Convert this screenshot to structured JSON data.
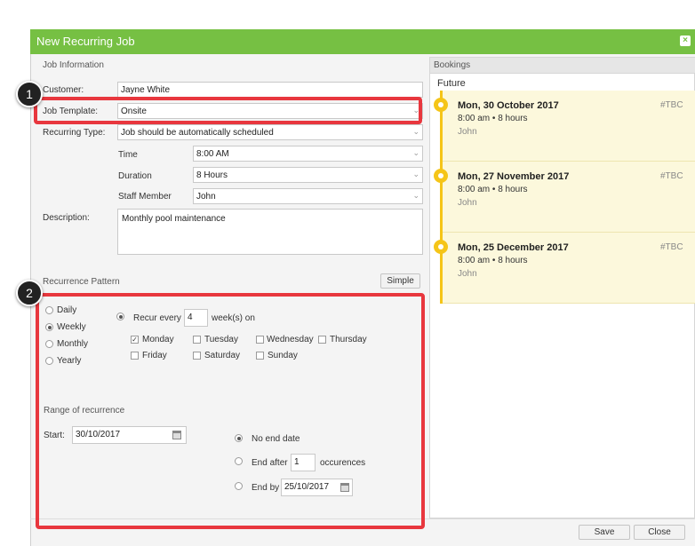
{
  "dialog": {
    "title": "New Recurring Job",
    "close_icon": "×"
  },
  "job_info": {
    "section_title": "Job Information",
    "customer_label": "Customer:",
    "customer_value": "Jayne White",
    "template_label": "Job Template:",
    "template_value": "Onsite",
    "recurring_type_label": "Recurring Type:",
    "recurring_type_value": "Job should be automatically scheduled",
    "time_label": "Time",
    "time_value": "8:00 AM",
    "duration_label": "Duration",
    "duration_value": "8 Hours",
    "staff_label": "Staff Member",
    "staff_value": "John",
    "description_label": "Description:",
    "description_value": "Monthly  pool maintenance"
  },
  "recurrence": {
    "section_title": "Recurrence Pattern",
    "simple_button": "Simple",
    "frequencies": [
      "Daily",
      "Weekly",
      "Monthly",
      "Yearly"
    ],
    "selected_frequency": "Weekly",
    "recur_every_label": "Recur every",
    "recur_every_value": "4",
    "recur_unit_label": "week(s) on",
    "days": [
      {
        "label": "Monday",
        "checked": true
      },
      {
        "label": "Tuesday",
        "checked": false
      },
      {
        "label": "Wednesday",
        "checked": false
      },
      {
        "label": "Thursday",
        "checked": false
      },
      {
        "label": "Friday",
        "checked": false
      },
      {
        "label": "Saturday",
        "checked": false
      },
      {
        "label": "Sunday",
        "checked": false
      }
    ]
  },
  "range": {
    "section_title": "Range of recurrence",
    "start_label": "Start:",
    "start_value": "30/10/2017",
    "no_end_label": "No end date",
    "end_after_label": "End after",
    "end_after_value": "1",
    "occurrences_label": "occurences",
    "end_by_label": "End by",
    "end_by_value": "25/10/2017",
    "selected": "No end date"
  },
  "bookings": {
    "title": "Bookings",
    "group": "Future",
    "items": [
      {
        "date": "Mon, 30 October 2017",
        "time": "8:00 am • 8 hours",
        "staff": "John",
        "tag": "#TBC"
      },
      {
        "date": "Mon, 27 November 2017",
        "time": "8:00 am • 8 hours",
        "staff": "John",
        "tag": "#TBC"
      },
      {
        "date": "Mon, 25 December 2017",
        "time": "8:00 am • 8 hours",
        "staff": "John",
        "tag": "#TBC"
      }
    ]
  },
  "footer": {
    "save_label": "Save",
    "close_label": "Close"
  },
  "annotations": {
    "badge_1": "1",
    "badge_2": "2"
  },
  "colors": {
    "titlebar": "#76c043",
    "callout": "#e8373e",
    "timeline": "#f5c518",
    "booking_bg": "#fcf8dc"
  }
}
